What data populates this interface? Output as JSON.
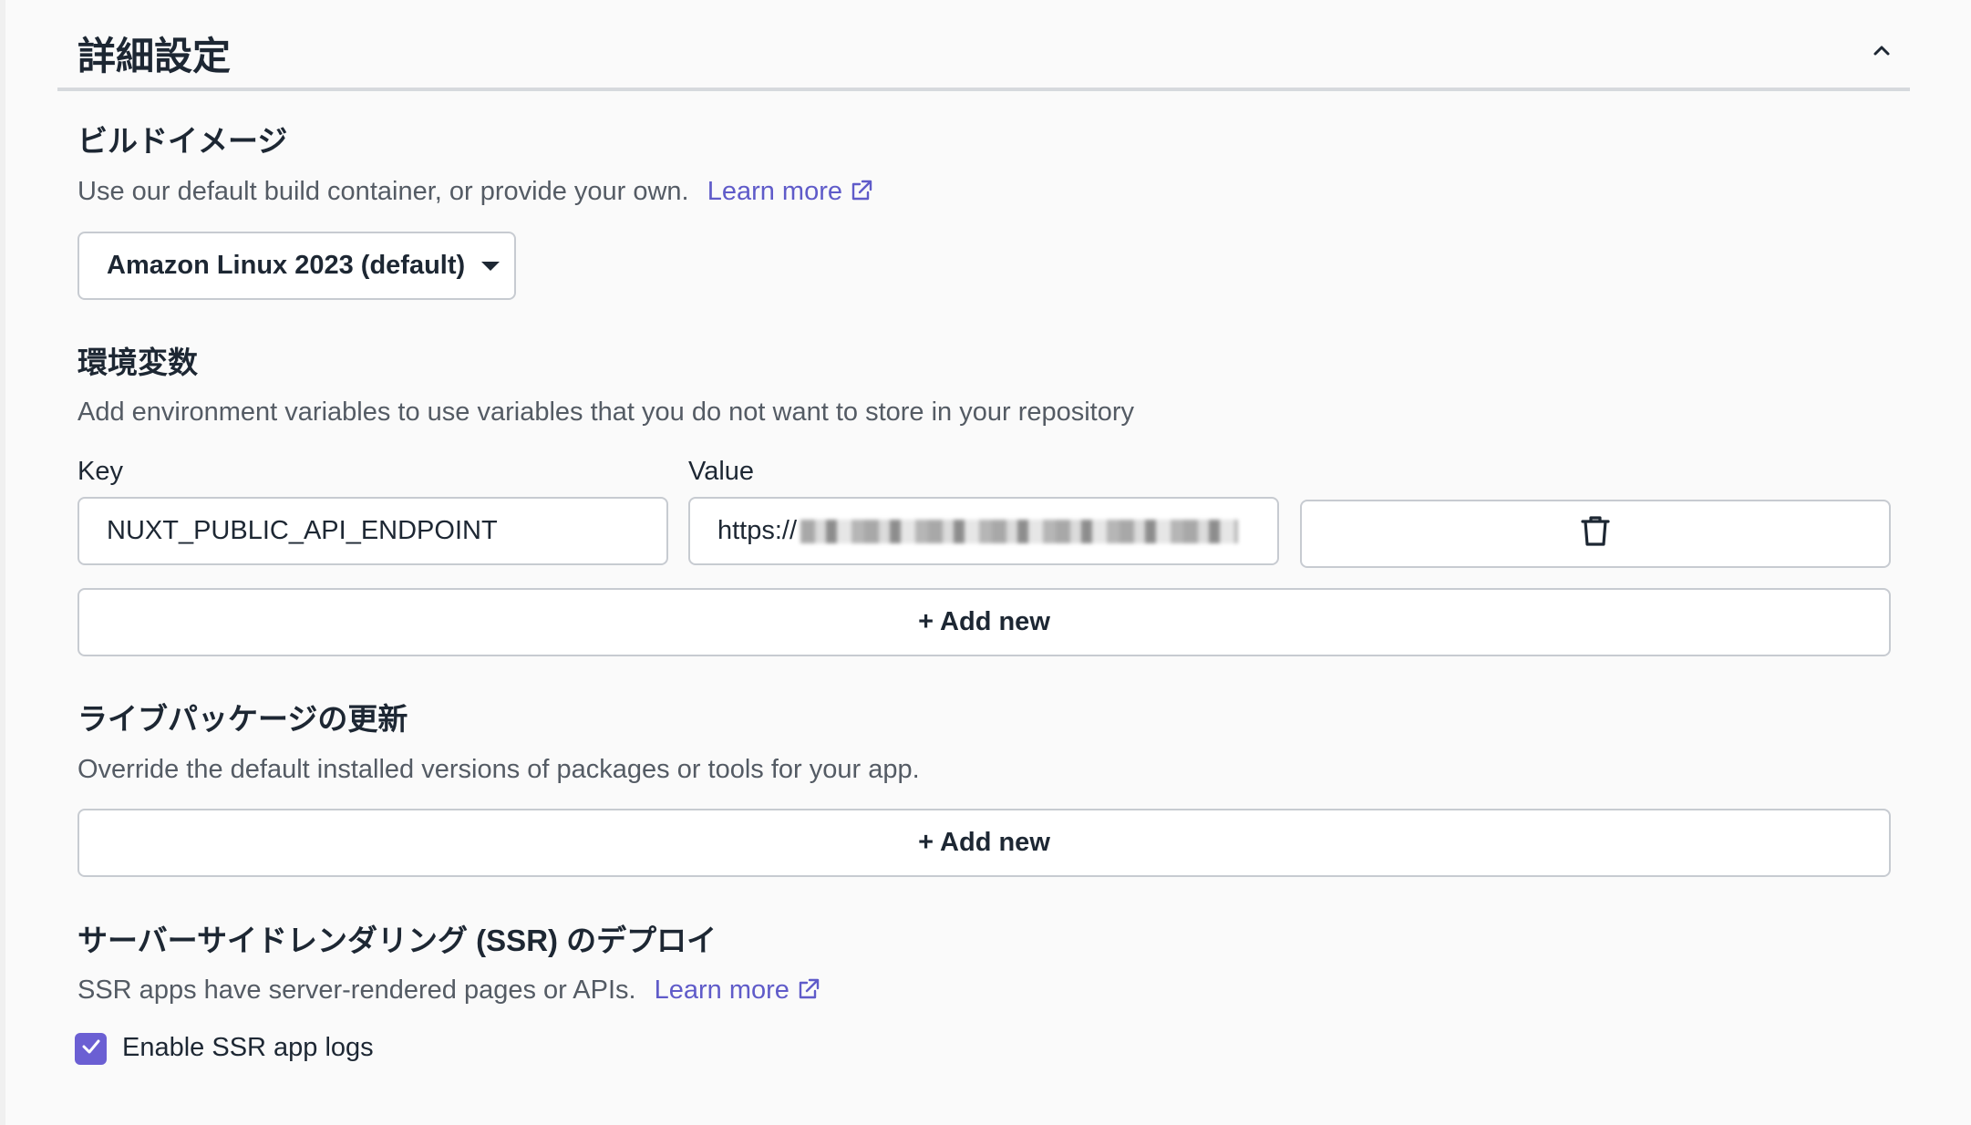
{
  "panel": {
    "title": "詳細設定",
    "collapse_icon": "chevron-up-icon"
  },
  "build_image": {
    "title": "ビルドイメージ",
    "description": "Use our default build container, or provide your own.",
    "learn_more": "Learn more",
    "selected": "Amazon Linux 2023 (default)"
  },
  "env_vars": {
    "title": "環境変数",
    "description": "Add environment variables to use variables that you do not want to store in your repository",
    "key_label": "Key",
    "value_label": "Value",
    "rows": [
      {
        "key": "NUXT_PUBLIC_API_ENDPOINT",
        "value": "https://"
      }
    ],
    "delete_icon": "trash-icon",
    "add_new": "+ Add new"
  },
  "live_packages": {
    "title": "ライブパッケージの更新",
    "description": "Override the default installed versions of packages or tools for your app.",
    "add_new": "+ Add new"
  },
  "ssr": {
    "title": "サーバーサイドレンダリング (SSR) のデプロイ",
    "description": "SSR apps have server-rendered pages or APIs.",
    "learn_more": "Learn more",
    "checkbox_label": "Enable SSR app logs",
    "checkbox_checked": true
  },
  "colors": {
    "accent": "#6b5fd3",
    "link": "#5f5bc9",
    "text": "#1d2733",
    "muted": "#545b64"
  }
}
